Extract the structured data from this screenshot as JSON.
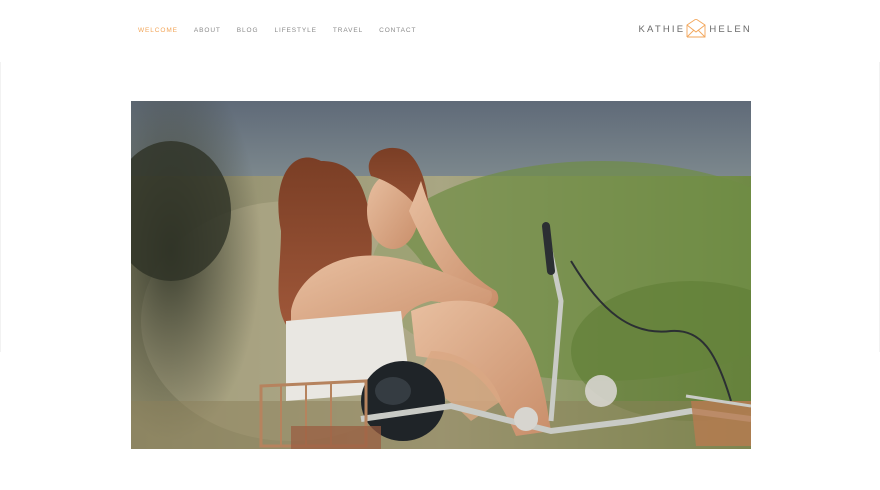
{
  "nav": {
    "items": [
      {
        "label": "WELCOME",
        "active": true
      },
      {
        "label": "ABOUT",
        "active": false
      },
      {
        "label": "BLOG",
        "active": false
      },
      {
        "label": "LIFESTYLE",
        "active": false
      },
      {
        "label": "TRAVEL",
        "active": false
      },
      {
        "label": "CONTACT",
        "active": false
      }
    ]
  },
  "logo": {
    "first": "KATHIE",
    "last": "HELEN",
    "icon": "envelope-icon",
    "accent_color": "#f2a65a"
  },
  "hero": {
    "description_icon": "photo"
  },
  "colors": {
    "nav_active": "#f2a65a",
    "nav_default": "#8a8a8a",
    "logo_text": "#6a6a6a"
  }
}
